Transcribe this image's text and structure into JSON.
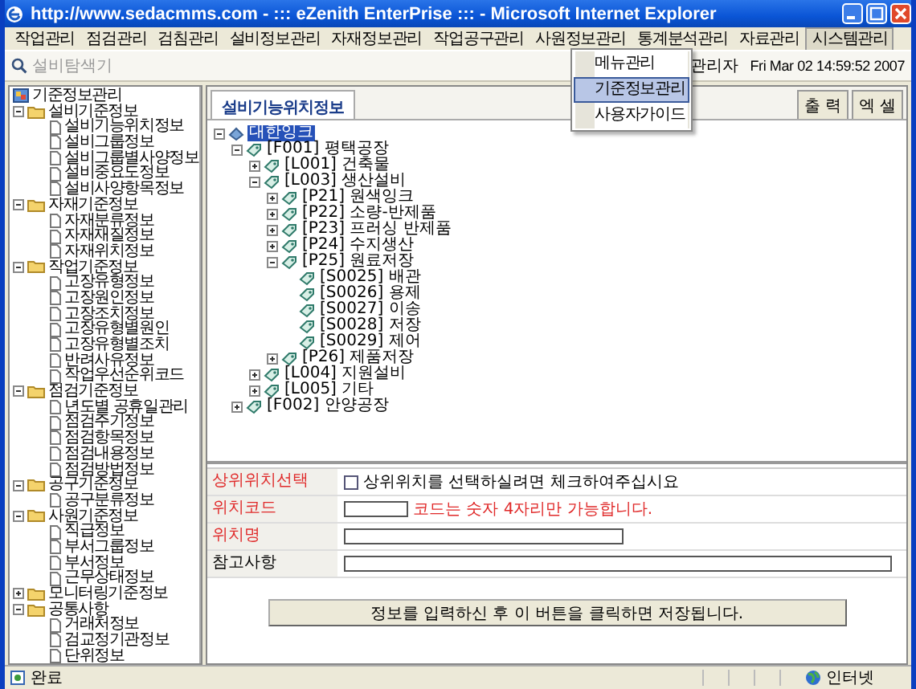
{
  "window": {
    "title": "http://www.sedacmms.com - ::: eZenith EnterPrise ::: - Microsoft Internet Explorer"
  },
  "menu_bar": [
    {
      "label": "작업관리",
      "selected": false
    },
    {
      "label": "점검관리",
      "selected": false
    },
    {
      "label": "검침관리",
      "selected": false
    },
    {
      "label": "설비정보관리",
      "selected": false
    },
    {
      "label": "자재정보관리",
      "selected": false
    },
    {
      "label": "작업공구관리",
      "selected": false
    },
    {
      "label": "사원정보관리",
      "selected": false
    },
    {
      "label": "통계분석관리",
      "selected": false
    },
    {
      "label": "자료관리",
      "selected": false
    },
    {
      "label": "시스템관리",
      "selected": true
    }
  ],
  "dropdown": {
    "items": [
      {
        "label": "메뉴관리",
        "selected": false
      },
      {
        "label": "기준정보관리",
        "selected": true
      },
      {
        "label": "사용자가이드",
        "selected": false
      }
    ]
  },
  "toolbar": {
    "search": {
      "placeholder": "설비탐색기"
    },
    "user": "관리자",
    "datetime": "Fri Mar 02 14:59:52 2007"
  },
  "sidebar": {
    "tree": [
      {
        "label": "기준정보관리",
        "kind": "root",
        "children": [
          {
            "label": "설비기준정보",
            "kind": "folder",
            "expanded": true,
            "children": [
              {
                "label": "설비기능위치정보",
                "kind": "page"
              },
              {
                "label": "설비그룹정보",
                "kind": "page"
              },
              {
                "label": "설비그룹별사양정보",
                "kind": "page"
              },
              {
                "label": "설비중요도정보",
                "kind": "page"
              },
              {
                "label": "설비사양항목정보",
                "kind": "page"
              }
            ]
          },
          {
            "label": "자재기준정보",
            "kind": "folder",
            "expanded": true,
            "children": [
              {
                "label": "자재분류정보",
                "kind": "page"
              },
              {
                "label": "자재재질정보",
                "kind": "page"
              },
              {
                "label": "자재위치정보",
                "kind": "page"
              }
            ]
          },
          {
            "label": "작업기준정보",
            "kind": "folder",
            "expanded": true,
            "children": [
              {
                "label": "고장유형정보",
                "kind": "page"
              },
              {
                "label": "고장원인정보",
                "kind": "page"
              },
              {
                "label": "고장조치정보",
                "kind": "page"
              },
              {
                "label": "고장유형별원인",
                "kind": "page"
              },
              {
                "label": "고장유형별조치",
                "kind": "page"
              },
              {
                "label": "반려사유정보",
                "kind": "page"
              },
              {
                "label": "작업우선순위코드",
                "kind": "page"
              }
            ]
          },
          {
            "label": "점검기준정보",
            "kind": "folder",
            "expanded": true,
            "children": [
              {
                "label": "년도별 공휴일관리",
                "kind": "page"
              },
              {
                "label": "점검주기정보",
                "kind": "page"
              },
              {
                "label": "점검항목정보",
                "kind": "page"
              },
              {
                "label": "점검내용정보",
                "kind": "page"
              },
              {
                "label": "점검방법정보",
                "kind": "page"
              }
            ]
          },
          {
            "label": "공구기준정보",
            "kind": "folder",
            "expanded": true,
            "children": [
              {
                "label": "공구분류정보",
                "kind": "page"
              }
            ]
          },
          {
            "label": "사원기준정보",
            "kind": "folder",
            "expanded": true,
            "children": [
              {
                "label": "직급정보",
                "kind": "page"
              },
              {
                "label": "부서그룹정보",
                "kind": "page"
              },
              {
                "label": "부서정보",
                "kind": "page"
              },
              {
                "label": "근무상태정보",
                "kind": "page"
              }
            ]
          },
          {
            "label": "모니터링기준정보",
            "kind": "folder",
            "expanded": false
          },
          {
            "label": "공통사항",
            "kind": "folder",
            "expanded": true,
            "children": [
              {
                "label": "거래처정보",
                "kind": "page"
              },
              {
                "label": "검교정기관정보",
                "kind": "page"
              },
              {
                "label": "단위정보",
                "kind": "page"
              }
            ]
          }
        ]
      }
    ]
  },
  "content": {
    "tab": "설비기능위치정보",
    "buttons": [
      "출 력",
      "엑 셀"
    ],
    "tree": [
      {
        "label": "대한잉크",
        "expanded": true,
        "selected": true,
        "children": [
          {
            "label": "[F001] 평택공장",
            "expanded": true,
            "selected": false,
            "children": [
              {
                "label": "[L001] 건축물",
                "expanded": false,
                "selected": false
              },
              {
                "label": "[L003] 생산설비",
                "expanded": true,
                "selected": false,
                "children": [
                  {
                    "label": "[P21] 원색잉크",
                    "expanded": false,
                    "selected": false
                  },
                  {
                    "label": "[P22] 소량-반제품",
                    "expanded": false,
                    "selected": false
                  },
                  {
                    "label": "[P23] 프러싱 반제품",
                    "expanded": false,
                    "selected": false
                  },
                  {
                    "label": "[P24] 수지생산",
                    "expanded": false,
                    "selected": false
                  },
                  {
                    "label": "[P25] 원료저장",
                    "expanded": true,
                    "selected": false,
                    "children": [
                      {
                        "label": "[S0025] 배관",
                        "selected": false
                      },
                      {
                        "label": "[S0026] 용제",
                        "selected": false
                      },
                      {
                        "label": "[S0027] 이송",
                        "selected": false
                      },
                      {
                        "label": "[S0028] 저장",
                        "selected": false
                      },
                      {
                        "label": "[S0029] 제어",
                        "selected": false
                      }
                    ]
                  },
                  {
                    "label": "[P26] 제품저장",
                    "expanded": false,
                    "selected": false
                  }
                ]
              },
              {
                "label": "[L004] 지원설비",
                "expanded": false,
                "selected": false
              },
              {
                "label": "[L005] 기타",
                "expanded": false,
                "selected": false
              }
            ]
          },
          {
            "label": "[F002] 안양공장",
            "expanded": false,
            "selected": false
          }
        ]
      }
    ],
    "form": [
      {
        "label": "상위위치선택",
        "required": true,
        "kind": "checkbox",
        "checked": false,
        "text": "상위위치를 선택하실려면 체크하여주십시요"
      },
      {
        "label": "위치코드",
        "required": true,
        "kind": "short",
        "hint": "코드는 숫자 4자리만 가능합니다."
      },
      {
        "label": "위치명",
        "required": true,
        "kind": "medium"
      },
      {
        "label": "참고사항",
        "required": false,
        "kind": "long"
      }
    ],
    "save_button": "정보를 입력하신 후 이 버튼을 클릭하면 저장됩니다."
  },
  "status_bar": {
    "text": "완료",
    "zone": "인터넷"
  }
}
